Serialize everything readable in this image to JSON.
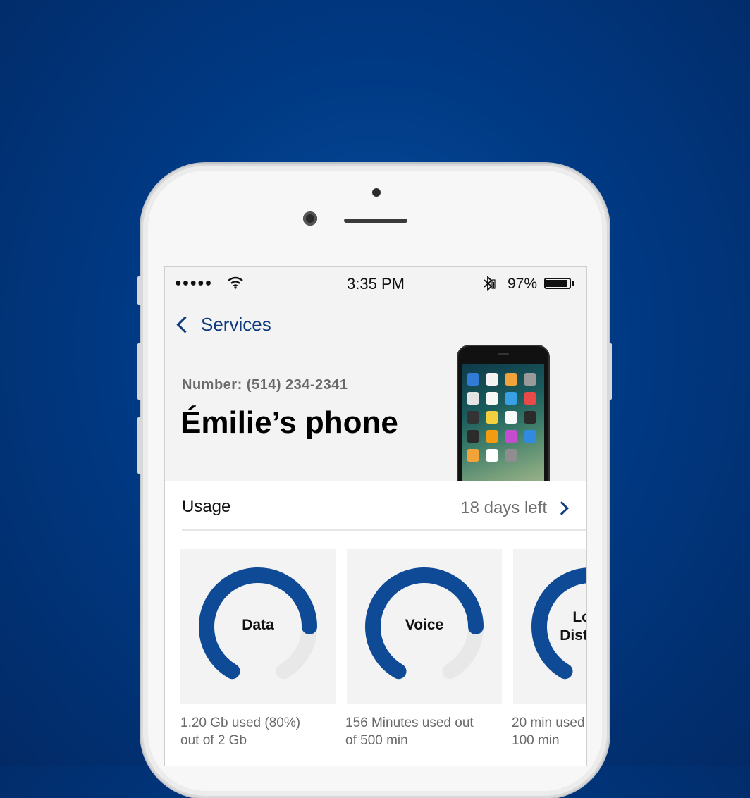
{
  "status_bar": {
    "signal": "●●●●●",
    "time": "3:35 PM",
    "battery_percent": "97%",
    "icons": [
      "signal-dots-icon",
      "wifi-icon",
      "bluetooth-icon",
      "battery-icon"
    ]
  },
  "nav": {
    "back_label": "Services",
    "back_icon": "chevron-left-icon"
  },
  "header": {
    "number": "Number: (514) 234-2341",
    "title": "Émilie’s phone"
  },
  "usage": {
    "label": "Usage",
    "days_left": "18 days left",
    "cards": [
      {
        "label": "Data",
        "caption_line1": "1.20 Gb used (80%)",
        "caption_line2": "out of 2 Gb",
        "fraction": 0.8
      },
      {
        "label": "Voice",
        "caption_line1": "156 Minutes used out",
        "caption_line2": "of 500 min",
        "fraction": 0.8
      },
      {
        "label": "Long Distance",
        "caption_line1": "20 min used",
        "caption_line2": "100 min",
        "fraction": 0.8
      }
    ]
  },
  "colors": {
    "accent": "#0f4a96",
    "track": "#e8e8e8",
    "background": "#023f8c"
  }
}
